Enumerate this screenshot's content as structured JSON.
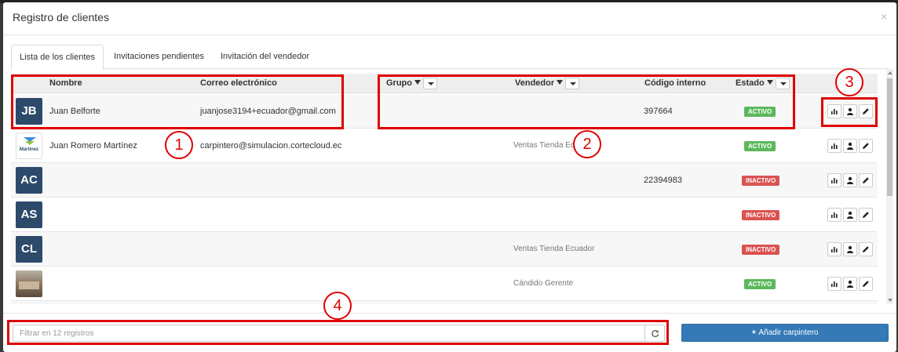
{
  "modal": {
    "title": "Registro de clientes",
    "close": "×"
  },
  "tabs": [
    {
      "label": "Lista de los clientes",
      "active": true
    },
    {
      "label": "Invitaciones pendientes",
      "active": false
    },
    {
      "label": "Invitación del vendedor",
      "active": false
    }
  ],
  "columns": {
    "nombre": "Nombre",
    "correo": "Correo electrónico",
    "grupo": "Grupo",
    "vendedor": "Vendedor",
    "codigo": "Código interno",
    "estado": "Estado"
  },
  "rows": [
    {
      "avatar": "JB",
      "avatar_type": "initials",
      "nombre": "Juan Belforte",
      "correo": "juanjose3194+ecuador@gmail.com",
      "vendedor": "",
      "codigo": "397664",
      "estado": "ACTIVO"
    },
    {
      "avatar": "Martínez",
      "avatar_type": "logo",
      "nombre": "Juan Romero Martínez",
      "correo": "carpintero@simulacion.cortecloud.ec",
      "vendedor": "Ventas Tienda Ecuador",
      "codigo": "",
      "estado": "ACTIVO"
    },
    {
      "avatar": "AC",
      "avatar_type": "initials",
      "nombre": "",
      "correo": "",
      "vendedor": "",
      "codigo": "22394983",
      "estado": "INACTIVO"
    },
    {
      "avatar": "AS",
      "avatar_type": "initials",
      "nombre": "",
      "correo": "",
      "vendedor": "",
      "codigo": "",
      "estado": "INACTIVO"
    },
    {
      "avatar": "CL",
      "avatar_type": "initials",
      "nombre": "",
      "correo": "",
      "vendedor": "Ventas Tienda Ecuador",
      "codigo": "",
      "estado": "INACTIVO"
    },
    {
      "avatar": "",
      "avatar_type": "photo",
      "nombre": "",
      "correo": "",
      "vendedor": "Cándido Gerente",
      "codigo": "",
      "estado": "ACTIVO"
    }
  ],
  "footer": {
    "search_placeholder": "Filtrar en 12 registros",
    "add_label": "Añadir carpintero",
    "add_plus": "+"
  },
  "annotations": [
    "1",
    "2",
    "3",
    "4"
  ],
  "colors": {
    "primary": "#337ab7",
    "active": "#5cb85c",
    "inactive": "#d9534f",
    "avatar": "#2d4a6b",
    "highlight": "#e00000"
  },
  "icons": {
    "stats": "bar-chart-icon",
    "user": "user-icon",
    "edit": "pencil-icon",
    "refresh": "refresh-icon",
    "filter": "filter-icon"
  }
}
